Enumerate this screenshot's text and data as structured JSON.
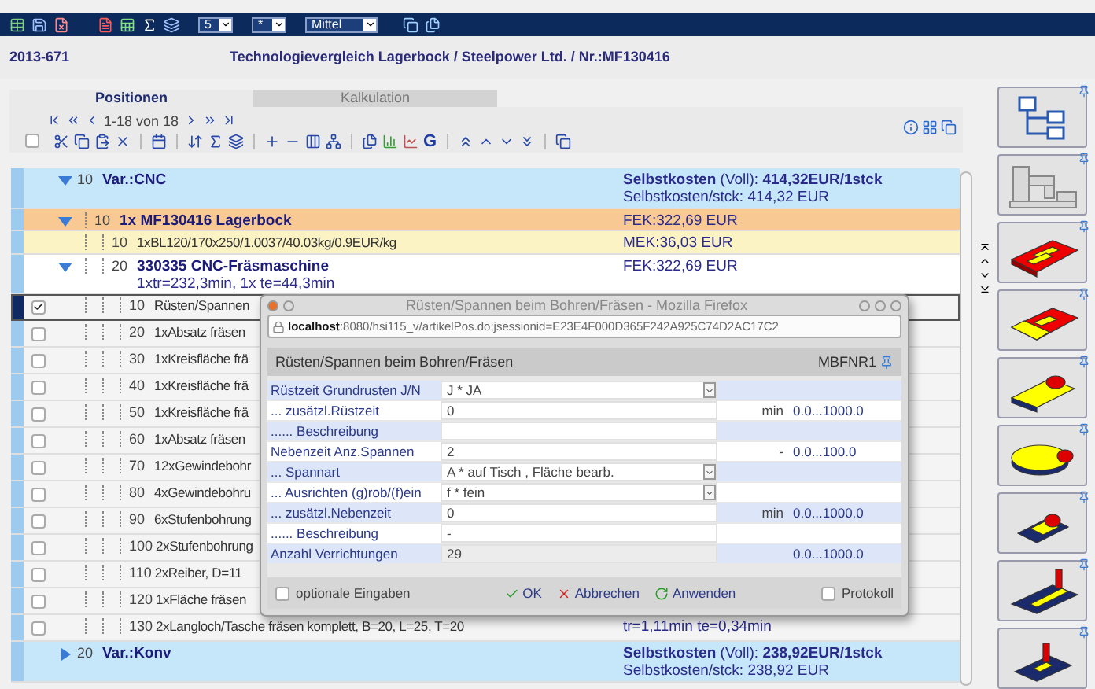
{
  "toolbar": {
    "page_size": "5",
    "filter": "*",
    "detail_level": "Mittel"
  },
  "header": {
    "number": "2013-671",
    "title": "Technologievergleich Lagerbock / Steelpower Ltd. / Nr.:MF130416"
  },
  "tabs": [
    {
      "label": "Positionen",
      "selected": true
    },
    {
      "label": "Kalkulation",
      "selected": false
    }
  ],
  "pager": {
    "range": "1-18 von 18"
  },
  "actions": {
    "graph_button": "G",
    "select_all": {
      "checked": false
    }
  },
  "list": {
    "rows": [
      {
        "kind": "group",
        "number": "10",
        "text": "Var.:CNC",
        "cost": "**Selbstkosten** (Voll): **414,32EUR/1stck**",
        "cost_sub": "Selbstkosten/stck: 414,32 EUR",
        "expanded": true,
        "selected": false,
        "children": [
          {
            "kind": "item",
            "number": "10",
            "text": "1x MF130416 Lagerbock",
            "cost": "FEK:322,69 EUR",
            "expanded": true,
            "selected": false,
            "children": [
              {
                "kind": "material",
                "number": "10",
                "text": "1xBL120/170x250/1.0037/40.03kg/0.9EUR/kg",
                "cost": "MEK:36,03 EUR",
                "selected": false
              },
              {
                "kind": "machine",
                "number": "20",
                "text": "330335 CNC-Fräsmaschine",
                "subtext": "1xtr=232,3min, 1x te=44,3min",
                "cost": "FEK:322,69 EUR",
                "expanded": true,
                "selected": false,
                "children": [
                  {
                    "kind": "step",
                    "number": "10",
                    "text": "Rüsten/Spannen",
                    "checked": true,
                    "selected": true
                  },
                  {
                    "kind": "step",
                    "number": "20",
                    "text": "1xAbsatz fräsen",
                    "checked": false,
                    "selected": false
                  },
                  {
                    "kind": "step",
                    "number": "30",
                    "text": "1xKreisfläche frä",
                    "checked": false,
                    "selected": false
                  },
                  {
                    "kind": "step",
                    "number": "40",
                    "text": "1xKreisfläche frä",
                    "checked": false,
                    "selected": false
                  },
                  {
                    "kind": "step",
                    "number": "50",
                    "text": "1xKreisfläche frä",
                    "checked": false,
                    "selected": false
                  },
                  {
                    "kind": "step",
                    "number": "60",
                    "text": "1xAbsatz fräsen",
                    "checked": false,
                    "selected": false
                  },
                  {
                    "kind": "step",
                    "number": "70",
                    "text": "12xGewindebohr",
                    "checked": false,
                    "selected": false
                  },
                  {
                    "kind": "step",
                    "number": "80",
                    "text": "4xGewindebohru",
                    "checked": false,
                    "selected": false
                  },
                  {
                    "kind": "step",
                    "number": "90",
                    "text": "6xStufenbohrung",
                    "checked": false,
                    "selected": false
                  },
                  {
                    "kind": "step",
                    "number": "100",
                    "text": "2xStufenbohrung",
                    "checked": false,
                    "selected": false
                  },
                  {
                    "kind": "step",
                    "number": "110",
                    "text": "2xReiber, D=11",
                    "checked": false,
                    "selected": false
                  },
                  {
                    "kind": "step",
                    "number": "120",
                    "text": "1xFläche fräsen",
                    "checked": false,
                    "selected": false
                  },
                  {
                    "kind": "step",
                    "number": "130",
                    "text": "2xLangloch/Tasche fräsen komplett, B=20, L=25, T=20",
                    "cost": "tr=1,11min te=0,34min",
                    "checked": false,
                    "selected": false
                  }
                ]
              }
            ]
          }
        ]
      },
      {
        "kind": "group",
        "number": "20",
        "text": "Var.:Konv",
        "cost": "**Selbstkosten** (Voll): **238,92EUR/1stck**",
        "cost_sub": "Selbstkosten/stck: 238,92 EUR",
        "expanded": false,
        "selected": false
      }
    ]
  },
  "dialog": {
    "window_title": "Rüsten/Spannen beim Bohren/Fräsen - Mozilla Firefox",
    "url": "**localhost**:8080/hsi115_v/artikelPos.do;jsessionid=E23E4F000D365F242A925C74D2AC17C2",
    "heading": "Rüsten/Spannen beim Bohren/Fräsen",
    "code": "MBFNR1",
    "fields": [
      {
        "kind": "select",
        "label": "Rüstzeit Grundrusten J/N",
        "value": "J * JA"
      },
      {
        "kind": "input",
        "label": "... zusätzl.Rüstzeit",
        "value": "0",
        "unit": "min",
        "range": "0.0...1000.0"
      },
      {
        "kind": "input",
        "label": "...... Beschreibung"
      },
      {
        "kind": "input",
        "label": "Nebenzeit Anz.Spannen",
        "value": "2",
        "unit": "-",
        "range": "0.0...100.0"
      },
      {
        "kind": "select",
        "label": "... Spannart",
        "value": "A * auf Tisch , Fläche bearb."
      },
      {
        "kind": "select",
        "label": "... Ausrichten (g)rob/(f)ein",
        "value": "f * fein"
      },
      {
        "kind": "input",
        "label": "... zusätzl.Nebenzeit",
        "value": "0",
        "unit": "min",
        "range": "0.0...1000.0"
      },
      {
        "kind": "input",
        "label": "...... Beschreibung",
        "value": "-"
      },
      {
        "kind": "readonly",
        "label": "Anzahl Verrichtungen",
        "value": "29",
        "range": "0.0...1000.0"
      }
    ],
    "optional": {
      "label": "optionale Eingaben",
      "checked": false
    },
    "buttons": [
      {
        "kind": "ok",
        "label": "OK"
      },
      {
        "kind": "cancel",
        "label": "Abbrechen"
      },
      {
        "kind": "apply",
        "label": "Anwenden"
      }
    ],
    "protocol": {
      "label": "Protokoll",
      "checked": false
    }
  }
}
